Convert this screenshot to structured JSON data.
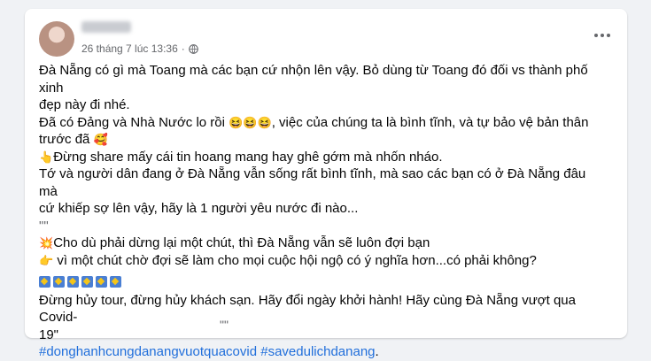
{
  "post": {
    "timestamp": "26 tháng 7 lúc 13:36",
    "separator": "·",
    "line1": "Đà Nẵng có gì mà Toang mà các bạn cứ nhộn lên vậy. Bỏ dùng từ Toang đó đối vs thành phố xinh",
    "line2": "đẹp này đi nhé.",
    "line3a": "Đã có Đảng và Nhà Nước lo rồi ",
    "line3_emoji": "😆😆😆",
    "line3b": ", việc của chúng ta là bình tĩnh, và tự bảo vệ bản thân",
    "line4a": "trước đã ",
    "line4_emoji": "🥰",
    "line5_emoji": "👆",
    "line5": "Đừng share mấy cái tin hoang mang hay ghê gớm mà nhốn nháo.",
    "line6": "Tớ và người dân đang ở Đà Nẵng vẫn sống rất bình tĩnh, mà sao các bạn có ở Đà Nẵng đâu mà",
    "line7": "cứ khiếp sợ lên vậy, hãy là 1 người yêu nước đi nào...",
    "line8": "\"\"",
    "line9_emoji": "💥",
    "line9": "Cho dù phải dừng lại một chút, thì Đà Nẵng vẫn sẽ luôn đợi bạn",
    "line10_emoji": "👉",
    "line10": " vì một chút chờ đợi sẽ làm cho mọi cuộc hội ngộ có ý nghĩa hơn...có phải không?",
    "line12": "Đừng hủy tour, đừng hủy khách sạn. Hãy đổi ngày khởi hành! Hãy cùng Đà Nẵng vượt qua Covid-",
    "line13": "19\"",
    "hashtag1": "#donghanhcungdanangvuotquacovid",
    "hashtag2": "#savedulichdanang",
    "hashtag_end": ".",
    "trailing": "\"\""
  },
  "icons": {
    "globe": "globe-icon",
    "more": "more-options-icon",
    "stars": "star-emoji-icon"
  },
  "colors": {
    "hashtag": "#216fdb",
    "meta": "#65676b"
  }
}
